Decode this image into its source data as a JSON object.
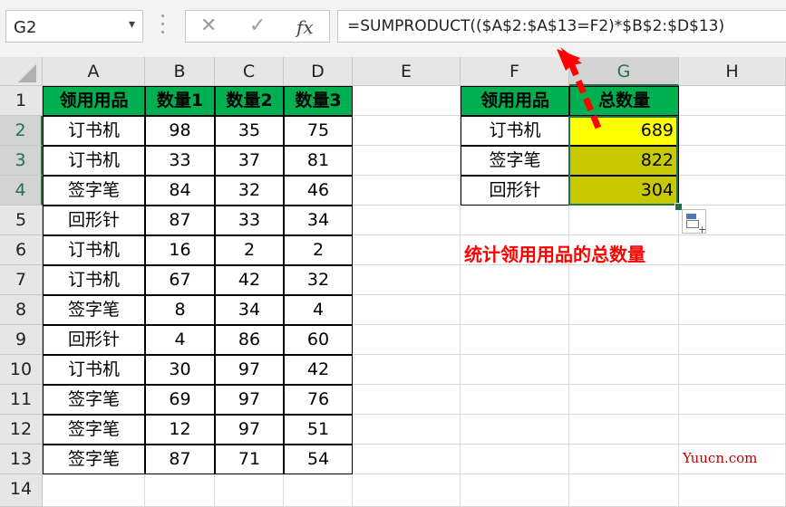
{
  "name_box": {
    "value": "G2"
  },
  "toolbar": {
    "cancel_symbol": "✕",
    "enter_symbol": "✓",
    "fx_symbol": "fx"
  },
  "formula": "=SUMPRODUCT(($A$2:$A$13=F2)*$B$2:$D$13)",
  "columns": [
    "A",
    "B",
    "C",
    "D",
    "E",
    "F",
    "G",
    "H"
  ],
  "rows": [
    "1",
    "2",
    "3",
    "4",
    "5",
    "6",
    "7",
    "8",
    "9",
    "10",
    "11",
    "12",
    "13",
    "14"
  ],
  "table1": {
    "headers": [
      "领用用品",
      "数量1",
      "数量2",
      "数量3"
    ],
    "rows": [
      [
        "订书机",
        "98",
        "35",
        "75"
      ],
      [
        "订书机",
        "33",
        "37",
        "81"
      ],
      [
        "签字笔",
        "84",
        "32",
        "46"
      ],
      [
        "回形针",
        "87",
        "33",
        "34"
      ],
      [
        "订书机",
        "16",
        "2",
        "2"
      ],
      [
        "订书机",
        "67",
        "42",
        "32"
      ],
      [
        "签字笔",
        "8",
        "34",
        "4"
      ],
      [
        "回形针",
        "4",
        "86",
        "60"
      ],
      [
        "订书机",
        "30",
        "97",
        "42"
      ],
      [
        "签字笔",
        "69",
        "97",
        "76"
      ],
      [
        "签字笔",
        "12",
        "97",
        "51"
      ],
      [
        "签字笔",
        "87",
        "71",
        "54"
      ]
    ]
  },
  "table2": {
    "headers": [
      "领用用品",
      "总数量"
    ],
    "rows": [
      [
        "订书机",
        "689"
      ],
      [
        "签字笔",
        "822"
      ],
      [
        "回形针",
        "304"
      ]
    ]
  },
  "note": "统计领用用品的总数量",
  "watermark": "Yuucn.com",
  "colors": {
    "header_green": "#00b050",
    "selected_yellow": "#ffff00",
    "fill_olive": "#c9c900",
    "arrow_red": "#ff0000",
    "accent": "#217346"
  }
}
